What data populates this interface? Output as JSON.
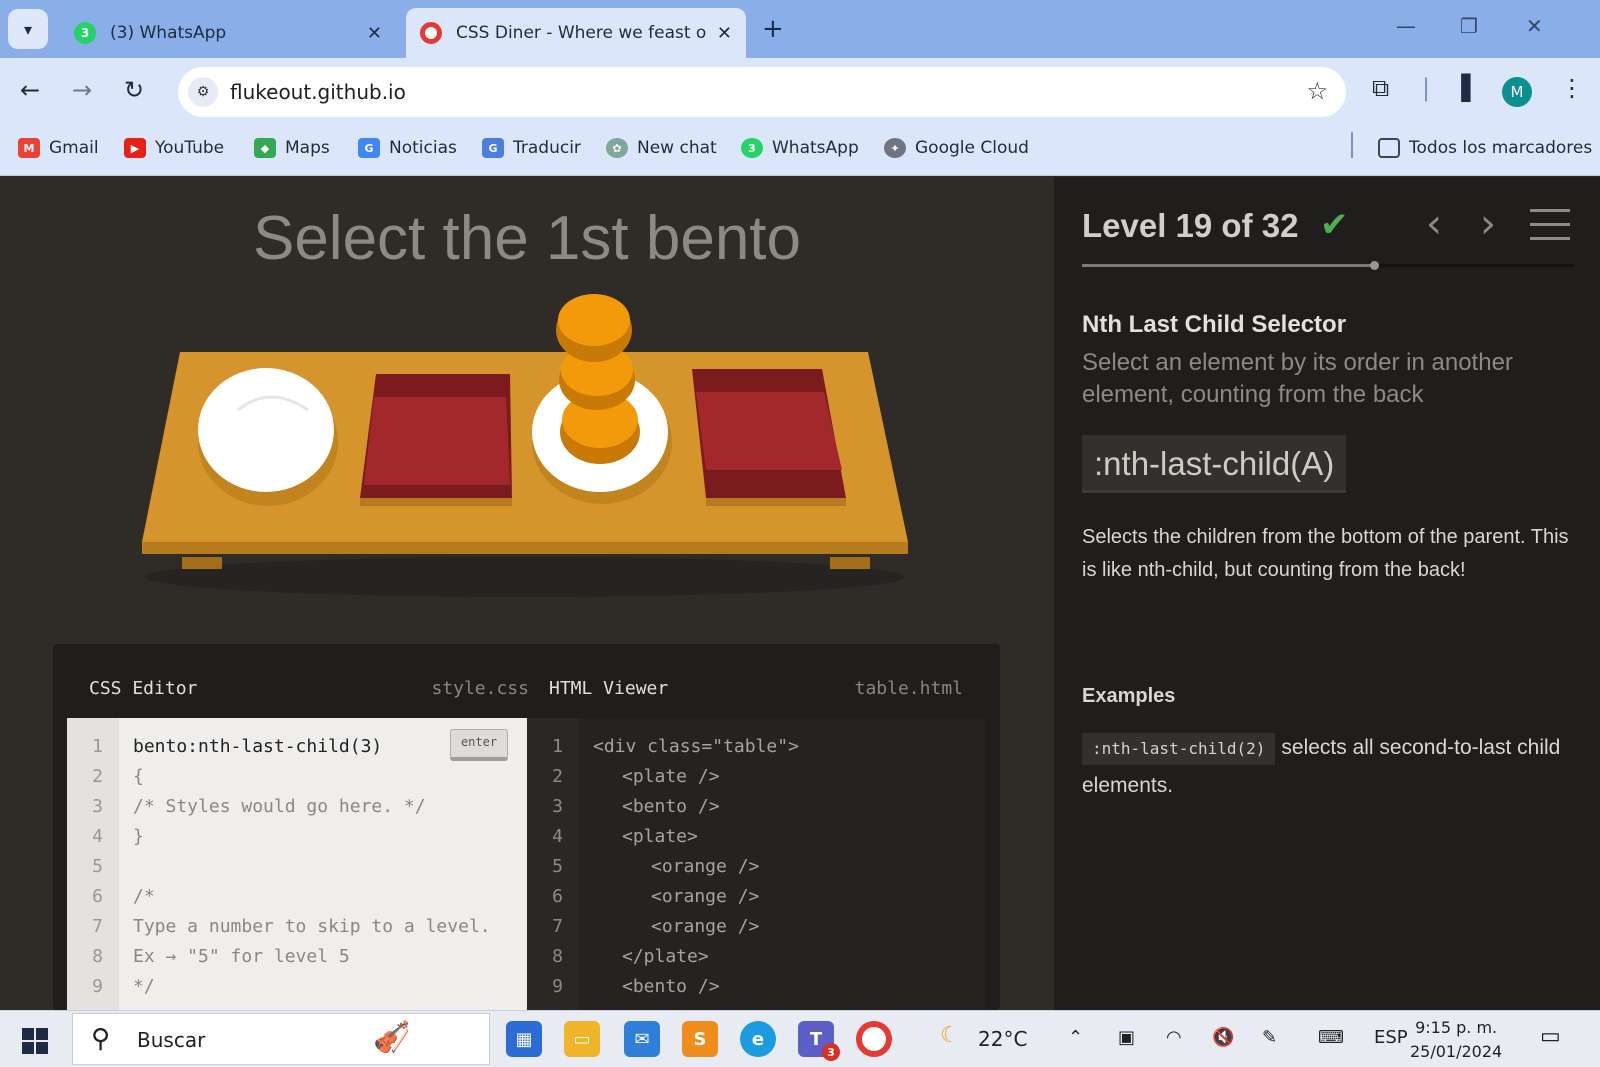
{
  "browser": {
    "tabs": [
      {
        "title": "(3) WhatsApp",
        "badge": "3",
        "active": false
      },
      {
        "title": "CSS Diner - Where we feast on CSS",
        "active": true
      }
    ],
    "url": "flukeout.github.io",
    "profile_initial": "M",
    "bookmarks": [
      {
        "label": "Gmail",
        "icon": "gmail-icon"
      },
      {
        "label": "YouTube",
        "icon": "youtube-icon"
      },
      {
        "label": "Maps",
        "icon": "maps-icon"
      },
      {
        "label": "Noticias",
        "icon": "news-icon"
      },
      {
        "label": "Traducir",
        "icon": "translate-icon"
      },
      {
        "label": "New chat",
        "icon": "chatgpt-icon"
      },
      {
        "label": "WhatsApp",
        "icon": "whatsapp-icon"
      },
      {
        "label": "Google Cloud",
        "icon": "cloud-icon"
      }
    ],
    "all_bookmarks": "Todos los marcadores"
  },
  "game": {
    "instruction": "Select the 1st bento",
    "css_editor": {
      "title": "CSS Editor",
      "file": "style.css",
      "enter_label": "enter",
      "line_numbers": [
        "1",
        "2",
        "3",
        "4",
        "5",
        "6",
        "7",
        "8",
        "9"
      ],
      "lines": [
        "bento:nth-last-child(3)",
        "{",
        "/* Styles would go here. */",
        "}",
        "",
        "/*",
        "Type a number to skip to a level.",
        "Ex → \"5\" for level 5",
        "*/"
      ]
    },
    "html_viewer": {
      "title": "HTML Viewer",
      "file": "table.html",
      "line_numbers": [
        "1",
        "2",
        "3",
        "4",
        "5",
        "6",
        "7",
        "8",
        "9"
      ],
      "lines": [
        "<div class=\"table\">",
        "<plate />",
        "<bento />",
        "<plate>",
        "<orange />",
        "<orange />",
        "<orange />",
        "</plate>",
        "<bento />"
      ]
    }
  },
  "sidebar": {
    "level_text": "Level 19 of 32",
    "level_current": 19,
    "level_total": 32,
    "completed": true,
    "selector_name": "Nth Last Child Selector",
    "selector_subtitle": "Select an element by its order in another element, counting from the back",
    "syntax": ":nth-last-child(A)",
    "description": "Selects the children from the bottom of the parent. This is like nth-child, but counting from the back!",
    "examples_heading": "Examples",
    "example_code": ":nth-last-child(2)",
    "example_text": "selects all second-to-last child elements."
  },
  "taskbar": {
    "search_placeholder": "Buscar",
    "weather": "22°C",
    "language": "ESP",
    "time": "9:15 p. m.",
    "date": "25/01/2024",
    "teams_badge": "3"
  },
  "colors": {
    "accent_check": "#4caf50",
    "tray": "#d6952c",
    "bento": "#a3282c",
    "orange": "#f39a0a"
  }
}
